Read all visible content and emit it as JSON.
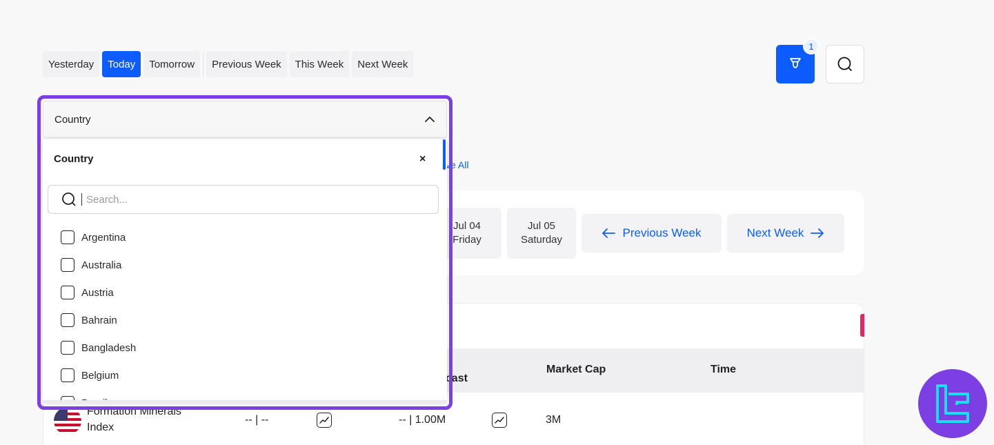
{
  "date_tabs": [
    {
      "label": "Yesterday"
    },
    {
      "label": "Today"
    },
    {
      "label": "Tomorrow"
    },
    {
      "label": "Previous Week"
    },
    {
      "label": "This Week"
    },
    {
      "label": "Next Week"
    }
  ],
  "active_date_tab": "Today",
  "filter_badge_count": "1",
  "dropdown": {
    "header_label": "Country",
    "panel_title": "Country",
    "close_label": "×",
    "search_placeholder": "Search...",
    "items": [
      "Argentina",
      "Australia",
      "Austria",
      "Bahrain",
      "Bangladesh",
      "Belgium",
      "Brazil"
    ]
  },
  "remove_all_partial": "ve All",
  "week_nav": {
    "days": [
      {
        "date": "Jul 04",
        "weekday": "Friday"
      },
      {
        "date": "Jul 05",
        "weekday": "Saturday"
      }
    ],
    "previous_label": "Previous Week",
    "next_label": "Next Week"
  },
  "table": {
    "headers": {
      "forecast_partial": "ecast",
      "market_cap": "Market Cap",
      "time": "Time"
    },
    "row": {
      "name_line1": "Formation Minerals",
      "name_line2": "Index",
      "actual": "-- | --",
      "forecast": "-- | 1.00M",
      "market_cap": "3M"
    }
  },
  "colors": {
    "accent": "#0d5cff",
    "highlight_outline": "#7b3fe4",
    "badge_pink": "#e8265e",
    "brand_cyan": "#19e0f0"
  },
  "icons": [
    "filter-icon",
    "search-icon",
    "chevron-up-icon",
    "close-icon",
    "arrow-left-icon",
    "arrow-right-icon",
    "trend-chart-icon",
    "brand-logo"
  ]
}
